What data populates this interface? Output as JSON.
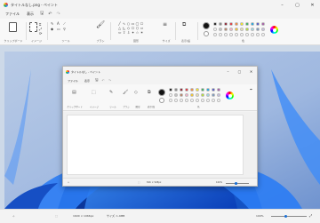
{
  "outer": {
    "title": "タイトルなし.png - ペイント",
    "window_controls": [
      "minimize-icon",
      "maximize-icon",
      "close-icon"
    ],
    "menu": {
      "file": "ファイル",
      "view": "表示"
    },
    "quick_actions": [
      "save-icon",
      "undo-icon",
      "redo-icon"
    ],
    "ribbon_groups": {
      "clipboard": "クリップボード",
      "image": "イメージ",
      "tools": "ツール",
      "brushes": "ブラシ",
      "shapes": "図形",
      "size": "サイズ",
      "layers": "表示/設",
      "colors": "色"
    },
    "status": {
      "dimensions": "1600 × 1066px",
      "file_size": "サイズ: 1.4MB",
      "zoom": "100%"
    }
  },
  "inner": {
    "title": "タイトルなし - ペイント",
    "menu": {
      "file": "ファイル",
      "view": "表示"
    },
    "ribbon_groups": {
      "clipboard": "クリップボード",
      "image": "イメージ",
      "tools": "ツール",
      "brushes": "ブラシ",
      "shapes": "図形",
      "layers": "表示/設",
      "colors": "色"
    },
    "status": {
      "dimensions": "816 × 528px",
      "zoom": "100%"
    }
  },
  "colors": {
    "accent": "#1a6fd4",
    "palette_row1": [
      "#000000",
      "#7f7f7f",
      "#880015",
      "#ed1c24",
      "#ff7f27",
      "#fff200",
      "#22b14c",
      "#00a2e8",
      "#3f48cc",
      "#a349a4"
    ],
    "palette_row2": [
      "#ffffff",
      "#c3c3c3",
      "#b97a57",
      "#ffaec9",
      "#ffc90e",
      "#efe4b0",
      "#b5e61d",
      "#99d9ea",
      "#7092be",
      "#c8bfe7"
    ],
    "palette_row3": [
      "#ffffff",
      "#ffffff",
      "#ffffff",
      "#ffffff",
      "#ffffff",
      "#ffffff",
      "#ffffff",
      "#ffffff",
      "#ffffff",
      "#ffffff"
    ]
  }
}
